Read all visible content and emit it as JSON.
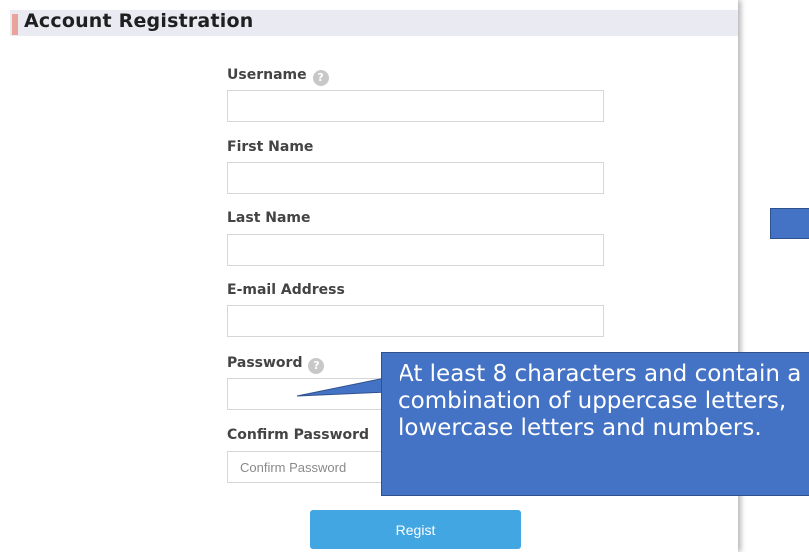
{
  "header": {
    "title": "Account Registration"
  },
  "form": {
    "username_label": "Username",
    "firstname_label": "First Name",
    "lastname_label": "Last Name",
    "email_label": "E-mail Address",
    "password_label": "Password",
    "confirm_password_label": "Confirm Password",
    "confirm_password_placeholder": "Confirm Password",
    "help_glyph": "?",
    "submit_label": "Regist"
  },
  "callout": {
    "text": "At least 8 characters and contain a combination of uppercase letters, lowercase letters and numbers."
  },
  "colors": {
    "header_bar": "#e9eaf2",
    "header_accent": "#e8a49b",
    "button": "#41a6e2",
    "callout": "#4472c4"
  },
  "icons": [
    "help-icon"
  ]
}
